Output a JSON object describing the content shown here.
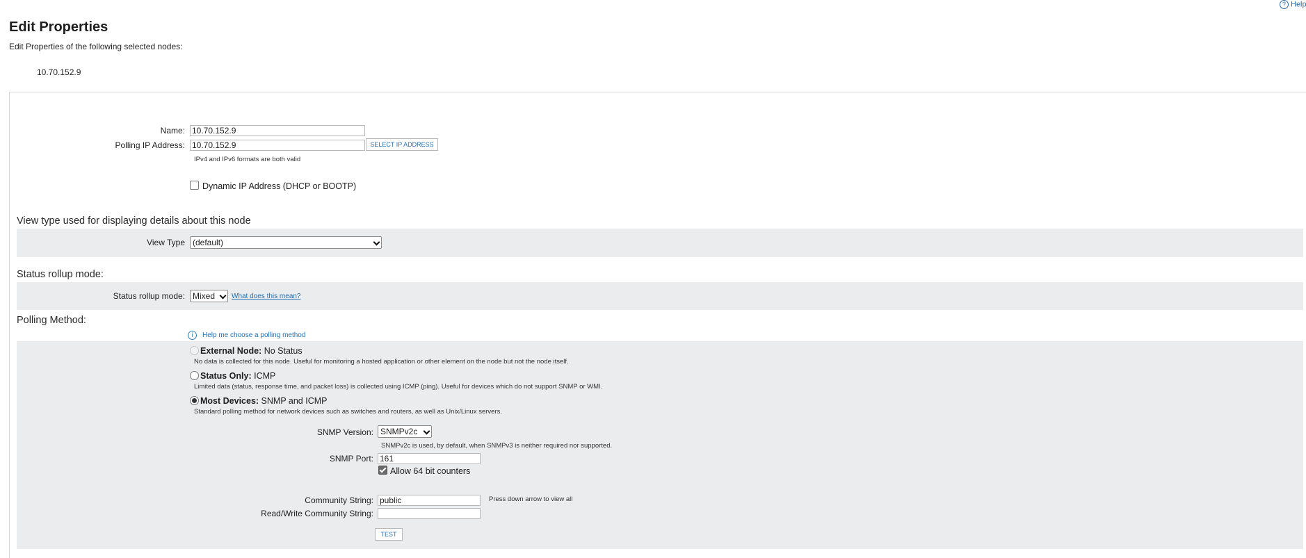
{
  "header": {
    "help_label": "Help",
    "title": "Edit Properties",
    "subtitle": "Edit Properties of the following selected nodes:",
    "selected_node": "10.70.152.9"
  },
  "general": {
    "name_label": "Name:",
    "name_value": "10.70.152.9",
    "polling_ip_label": "Polling IP Address:",
    "polling_ip_value": "10.70.152.9",
    "select_ip_button": "SELECT IP ADDRESS",
    "ip_hint": "IPv4 and IPv6 formats are both valid",
    "dynamic_ip_label": "Dynamic IP Address (DHCP or BOOTP)",
    "dynamic_ip_checked": false
  },
  "view_type": {
    "section_title": "View type used for displaying details about this node",
    "label": "View Type",
    "selected": "(default)"
  },
  "status_rollup": {
    "section_title": "Status rollup mode:",
    "label": "Status rollup mode:",
    "selected": "Mixed",
    "help_link": "What does this mean?"
  },
  "polling": {
    "section_title": "Polling Method:",
    "help_link": "Help me choose a polling method",
    "options": [
      {
        "bold": "External Node:",
        "rest": " No Status",
        "description": "No data is collected for this node. Useful for monitoring a hosted application or other element on the node but not the node itself.",
        "state": "disabled"
      },
      {
        "bold": "Status Only:",
        "rest": " ICMP",
        "description": "Limited data (status, response time, and packet loss) is collected using ICMP (ping). Useful for devices which do not support SNMP or WMI.",
        "state": "unchecked"
      },
      {
        "bold": "Most Devices:",
        "rest": " SNMP and ICMP",
        "description": "Standard polling method for network devices such as switches and routers, as well as Unix/Linux servers.",
        "state": "checked"
      }
    ]
  },
  "snmp": {
    "version_label": "SNMP Version:",
    "version_selected": "SNMPv2c",
    "version_hint": "SNMPv2c is used, by default, when SNMPv3 is neither required nor supported.",
    "port_label": "SNMP Port:",
    "port_value": "161",
    "counters_label": "Allow 64 bit counters",
    "counters_checked": true,
    "community_label": "Community String:",
    "community_value": "public",
    "community_hint": "Press down arrow to view all",
    "rw_community_label": "Read/Write Community String:",
    "rw_community_value": "",
    "test_button": "TEST"
  }
}
